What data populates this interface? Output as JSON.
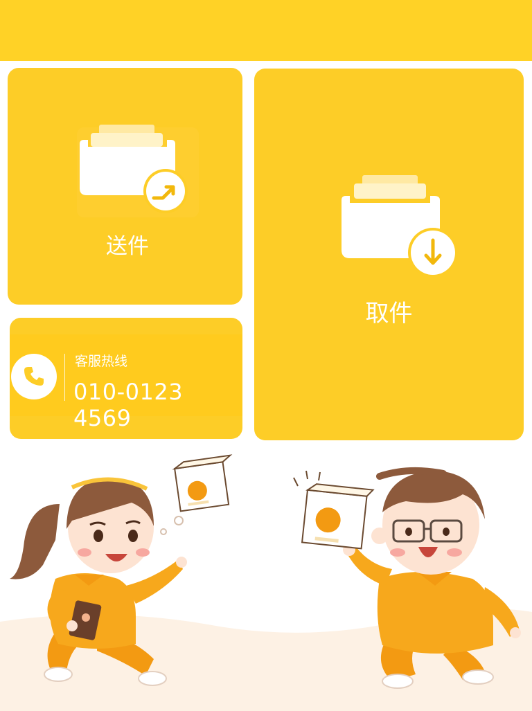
{
  "colors": {
    "brand_yellow": "#ffd226",
    "card_yellow": "#fdcd27",
    "shirt_orange": "#f7a81c",
    "hair_brown": "#8d5a3c"
  },
  "cards": {
    "send": {
      "label": "送件",
      "icon": "folder-send-icon"
    },
    "receive": {
      "label": "取件",
      "icon": "folder-download-icon"
    }
  },
  "hotline": {
    "title": "客服热线",
    "number": "010-0123 4569",
    "icon": "phone-icon"
  },
  "illustration": {
    "description_icon": "couriers-illustration"
  }
}
